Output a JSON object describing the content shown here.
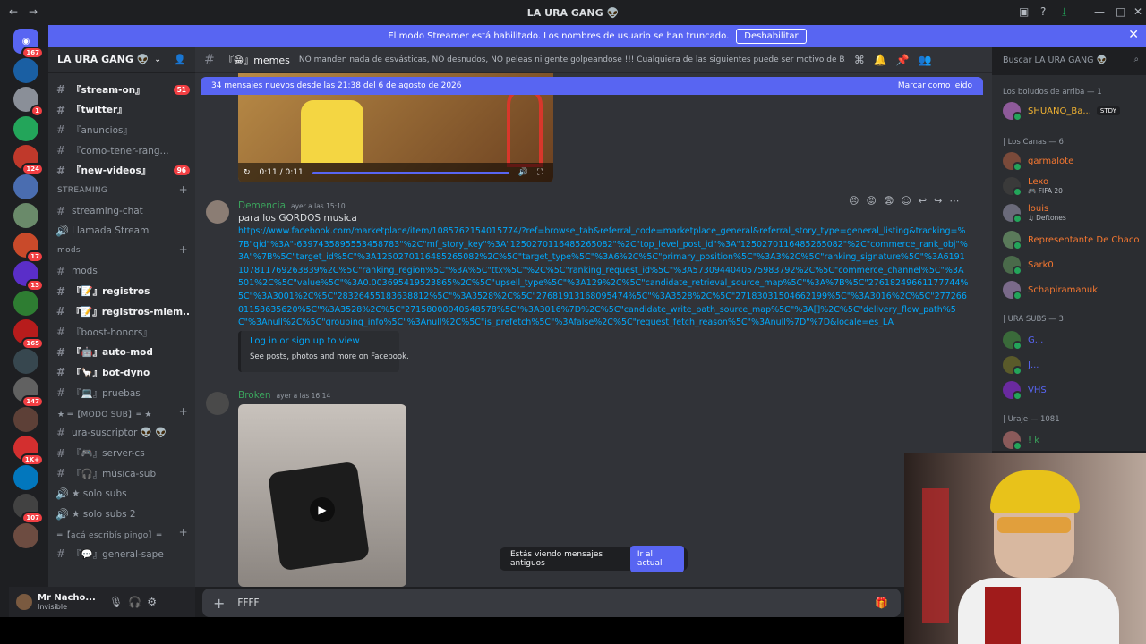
{
  "window": {
    "title": "LA URA GANG 👽"
  },
  "banner": {
    "text": "El modo Streamer está habilitado. Los nombres de usuario se han truncado.",
    "button": "Deshabilitar"
  },
  "servers": [
    {
      "badge": "167",
      "color": "#5865f2",
      "icon": "discord-icon"
    },
    {
      "badge": "",
      "color": "#1a5fa3"
    },
    {
      "badge": "1",
      "color": "#8a8f98"
    },
    {
      "badge": "",
      "color": "#23a55a"
    },
    {
      "badge": "124",
      "color": "#c0392b"
    },
    {
      "badge": "",
      "color": "#4a6db0"
    },
    {
      "badge": "",
      "color": "#6a8a6a"
    },
    {
      "badge": "17",
      "color": "#c94a2a"
    },
    {
      "badge": "13",
      "color": "#5a2ec8"
    },
    {
      "badge": "",
      "color": "#2e7d32"
    },
    {
      "badge": "165",
      "color": "#b71c1c"
    },
    {
      "badge": "",
      "color": "#37474f"
    },
    {
      "badge": "147",
      "color": "#616161"
    },
    {
      "badge": "",
      "color": "#5d4037"
    },
    {
      "badge": "1K+",
      "color": "#d32f2f"
    },
    {
      "badge": "",
      "color": "#0277bd"
    },
    {
      "badge": "107",
      "color": "#424242"
    },
    {
      "badge": "",
      "color": "#6d4c41"
    }
  ],
  "server_name": "LA URA GANG 👽",
  "channels_top": [
    {
      "name": "『stream-on』",
      "badge": "51",
      "unread": true
    },
    {
      "name": "『twitter』",
      "badge": "",
      "unread": true
    },
    {
      "name": "『anuncios』",
      "badge": "",
      "unread": false
    },
    {
      "name": "『como-tener-rang...",
      "badge": "",
      "unread": false
    },
    {
      "name": "『new-videos』",
      "badge": "96",
      "unread": true
    }
  ],
  "cat_streaming": "STREAMING",
  "channels_streaming": [
    {
      "name": "streaming-chat"
    },
    {
      "name": "Llamada Stream"
    }
  ],
  "cat_mods": "mods",
  "channels_mods": [
    {
      "name": "mods",
      "unread": false
    },
    {
      "name": "『📝』registros",
      "unread": true
    },
    {
      "name": "『📝』registros-miem...",
      "unread": true
    },
    {
      "name": "『boost-honors』",
      "unread": false
    },
    {
      "name": "『🤖』auto-mod",
      "unread": true
    },
    {
      "name": "『🦙』bot-dyno",
      "unread": true
    },
    {
      "name": "『💻』pruebas",
      "unread": false
    }
  ],
  "cat_sub": "★ ═【MODO SUB】═ ★",
  "channels_sub": [
    {
      "name": "ura-suscriptor 👽 👽"
    },
    {
      "name": "『🎮』server-cs"
    },
    {
      "name": "『🎧』música-sub"
    },
    {
      "name": "★ solo subs"
    },
    {
      "name": "★ solo subs 2"
    }
  ],
  "cat_pingo": "═【acá escribís pingo】═",
  "channels_pingo": [
    {
      "name": "『💬』general-sape"
    }
  ],
  "user": {
    "name": "Mr Nacho...",
    "status": "Invisible"
  },
  "header": {
    "channel": "『😁』memes",
    "topic": "NO manden nada de esvásticas, NO desnudos, NO peleas ni gente golpeandose !!! Cualquiera de las siguientes puede ser motivo de BAN, cuiden el stream!"
  },
  "newbar": {
    "text": "34 mensajes nuevos desde las 21:38 del 6 de agosto de 2026",
    "action": "Marcar como leído"
  },
  "video": {
    "time": "0:11 / 0:11"
  },
  "msg1": {
    "author": "Demencia",
    "time": "ayer a las 15:10",
    "text": "para los GORDOS musica",
    "link": "https://www.facebook.com/marketplace/item/1085762154015774/?ref=browse_tab&referral_code=marketplace_general&referral_story_type=general_listing&tracking=%7B\"qid\"%3A\"-6397435895553458783\"%2C\"mf_story_key\"%3A\"1250270116485265082\"%2C\"top_level_post_id\"%3A\"1250270116485265082\"%2C\"commerce_rank_obj\"%3A\"%7B%5C\"target_id%5C\"%3A1250270116485265082%2C%5C\"target_type%5C\"%3A6%2C%5C\"primary_position%5C\"%3A3%2C%5C\"ranking_signature%5C\"%3A6191107811769263839%2C%5C\"ranking_region%5C\"%3A%5C\"ttx%5C\"%2C%5C\"ranking_request_id%5C\"%3A5730944040575983792%2C%5C\"commerce_channel%5C\"%3A501%2C%5C\"value%5C\"%3A0.003695419523865%2C%5C\"upsell_type%5C\"%3A129%2C%5C\"candidate_retrieval_source_map%5C\"%3A%7B%5C\"27618249661177744%5C\"%3A3001%2C%5C\"28326455183638812%5C\"%3A3528%2C%5C\"27681913168095474%5C\"%3A3528%2C%5C\"27183031504662199%5C\"%3A3016%2C%5C\"27726601153635620%5C\"%3A3528%2C%5C\"27158000040548578%5C\"%3A3016%7D%2C%5C\"candidate_write_path_source_map%5C\"%3A[]%2C%5C\"delivery_flow_path%5C\"%3Anull%2C%5C\"grouping_info%5C\"%3Anull%2C%5C\"is_prefetch%5C\"%3Afalse%2C%5C\"request_fetch_reason%5C\"%3Anull%7D\"%7D&locale=es_LA",
    "embed_title": "Log in or sign up to view",
    "embed_desc": "See posts, photos and more on Facebook."
  },
  "msg2": {
    "author": "Broken",
    "time": "ayer a las 16:14"
  },
  "oldmsgs": {
    "text": "Estás viendo mensajes antiguos",
    "button": "Ir al actual"
  },
  "composer": {
    "value": "FFFF"
  },
  "search": {
    "placeholder": "Buscar LA URA GANG 👽"
  },
  "groups": {
    "g1": "Los boludos de arriba — 1",
    "g2": "| Los Canas — 6",
    "g3": "| URA SUBS — 3",
    "g4": "| Uraje — 1081"
  },
  "members": [
    {
      "name": "SHUANO_Ba...",
      "status": "",
      "color": "#f0b232",
      "tag": "STDY"
    },
    {
      "name": "garmalote",
      "status": "",
      "color": "#f57731"
    },
    {
      "name": "Lexo",
      "status": "🎮 FIFA 20",
      "color": "#f57731"
    },
    {
      "name": "louis",
      "status": "♫ Deftones",
      "color": "#f57731"
    },
    {
      "name": "Representante De Chaco",
      "status": "",
      "color": "#f57731"
    },
    {
      "name": "Sark0",
      "status": "",
      "color": "#f57731"
    },
    {
      "name": "Schapiramanuk",
      "status": "",
      "color": "#f57731"
    },
    {
      "name": "G...",
      "status": "",
      "color": "#5865f2"
    },
    {
      "name": "J...",
      "status": "",
      "color": "#5865f2"
    },
    {
      "name": "VHS",
      "status": "",
      "color": "#5865f2"
    },
    {
      "name": "! k",
      "status": "",
      "color": "#3ba55d"
    }
  ]
}
